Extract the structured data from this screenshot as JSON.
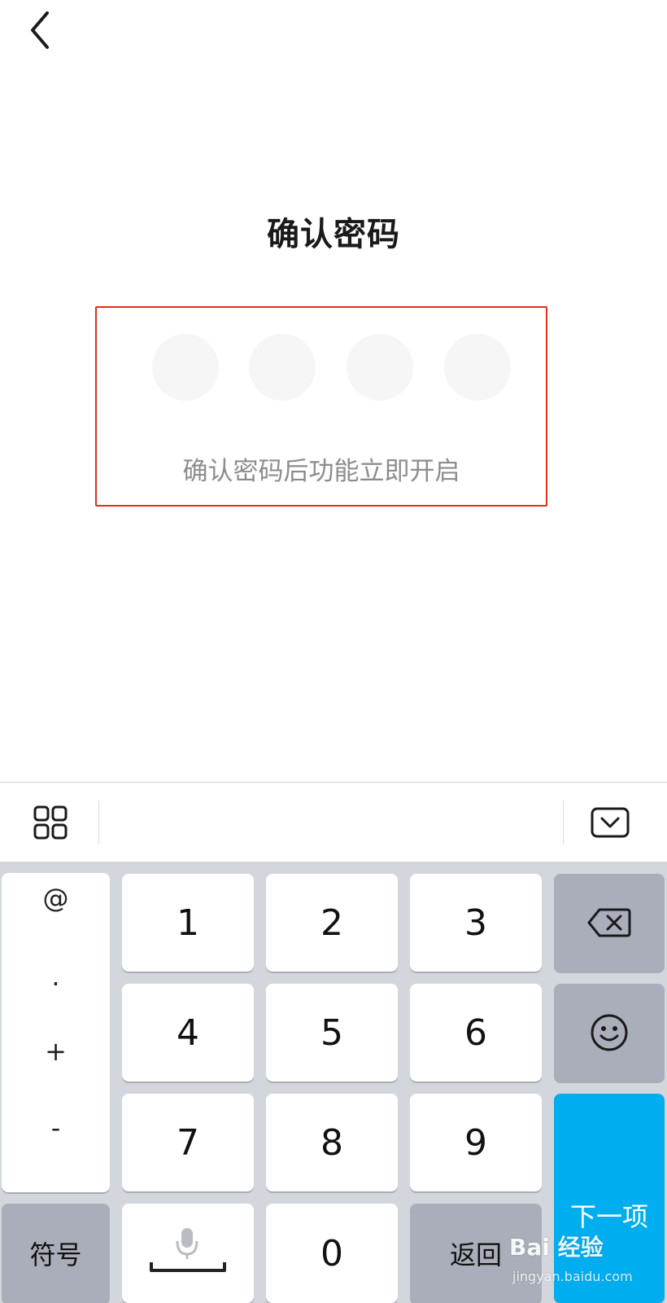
{
  "header": {
    "back_icon": "chevron-left-icon",
    "title": "确认密码"
  },
  "pin": {
    "dots": 4,
    "filled": 0,
    "hint": "确认密码后功能立即开启",
    "highlight_color": "#e0301e"
  },
  "toolbar": {
    "apps_icon": "grid-icon",
    "hide_icon": "keyboard-hide-icon"
  },
  "keyboard": {
    "symbols": [
      "@",
      ".",
      "+",
      "-"
    ],
    "digits": [
      "1",
      "2",
      "3",
      "4",
      "5",
      "6",
      "7",
      "8",
      "9"
    ],
    "zero": "0",
    "symbol_key": "符号",
    "space_icon": "microphone-icon",
    "return_key": "返回",
    "backspace_icon": "backspace-icon",
    "emoji_icon": "smiley-icon",
    "next_key": "下一项",
    "accent_color": "#00aef0"
  },
  "watermark": {
    "brand": "Bai 经验",
    "url": "jingyan.baidu.com"
  }
}
